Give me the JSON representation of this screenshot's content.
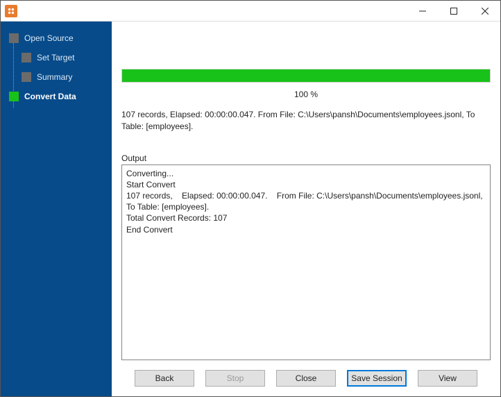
{
  "nav": {
    "items": [
      {
        "label": "Open Source",
        "level": 0,
        "active": false
      },
      {
        "label": "Set Target",
        "level": 1,
        "active": false
      },
      {
        "label": "Summary",
        "level": 1,
        "active": false
      },
      {
        "label": "Convert Data",
        "level": 0,
        "active": true
      }
    ]
  },
  "progress": {
    "percent_text": "100 %",
    "percent_value": 100
  },
  "status": {
    "text": "107 records,    Elapsed: 00:00:00.047.    From File: C:\\Users\\pansh\\Documents\\employees.jsonl,    To Table: [employees]."
  },
  "output": {
    "label": "Output",
    "lines_text": "Converting...\nStart Convert\n107 records,    Elapsed: 00:00:00.047.    From File: C:\\Users\\pansh\\Documents\\employees.jsonl,    To Table: [employees].\nTotal Convert Records: 107\nEnd Convert"
  },
  "buttons": {
    "back": "Back",
    "stop": "Stop",
    "close": "Close",
    "save": "Save Session",
    "view": "View"
  }
}
